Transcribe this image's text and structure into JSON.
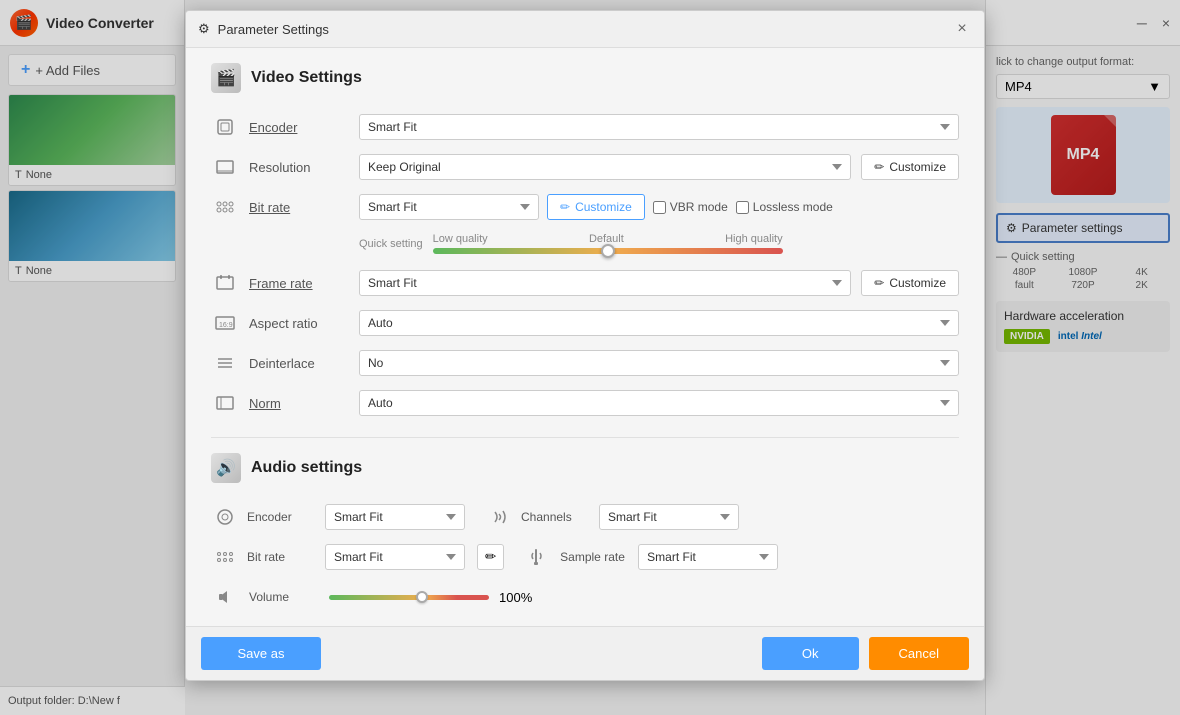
{
  "app": {
    "title": "Video Converter",
    "add_files_label": "+ Add Files",
    "output_folder_label": "Output folder:",
    "output_folder_path": "D:\\New f"
  },
  "right_panel": {
    "format_prompt": "lick to change output format:",
    "format_name": "MP4",
    "mp4_label": "MP4",
    "parameter_settings_label": "Parameter settings",
    "quick_setting_label": "Quick setting",
    "quality_labels_top": [
      "480P",
      "1080P",
      "4K"
    ],
    "quality_labels_bottom": [
      "fault",
      "720P",
      "2K"
    ],
    "hardware_acceleration_title": "Hardware acceleration",
    "nvidia_label": "NVIDIA",
    "intel_label": "intel",
    "intel_label2": "Intel"
  },
  "dialog": {
    "title": "Parameter Settings",
    "close_label": "×",
    "video_section_title": "Video Settings",
    "encoder_label": "Encoder",
    "encoder_value": "Smart Fit",
    "resolution_label": "Resolution",
    "resolution_value": "Keep Original",
    "customize_label1": "Customize",
    "bitrate_label": "Bit rate",
    "bitrate_value": "Smart Fit",
    "customize_label2": "Customize",
    "vbr_mode_label": "VBR mode",
    "lossless_mode_label": "Lossless mode",
    "quick_setting_label": "Quick setting",
    "quality_low": "Low quality",
    "quality_default": "Default",
    "quality_high": "High quality",
    "framerate_label": "Frame rate",
    "framerate_value": "Smart Fit",
    "customize_label3": "Customize",
    "aspect_ratio_label": "Aspect ratio",
    "aspect_ratio_value": "Auto",
    "deinterlace_label": "Deinterlace",
    "deinterlace_value": "No",
    "norm_label": "Norm",
    "norm_value": "Auto",
    "audio_section_title": "Audio settings",
    "audio_encoder_label": "Encoder",
    "audio_encoder_value": "Smart Fit",
    "channels_label": "Channels",
    "channels_value": "Smart Fit",
    "audio_bitrate_label": "Bit rate",
    "audio_bitrate_value": "Smart Fit",
    "sample_rate_label": "Sample rate",
    "sample_rate_value": "Smart Fit",
    "volume_label": "Volume",
    "volume_value": "100%",
    "save_as_label": "Save as",
    "ok_label": "Ok",
    "cancel_label": "Cancel"
  },
  "thumbnails": [
    {
      "type": "landscape",
      "label": "None"
    },
    {
      "type": "waterfall",
      "label": "None"
    }
  ]
}
